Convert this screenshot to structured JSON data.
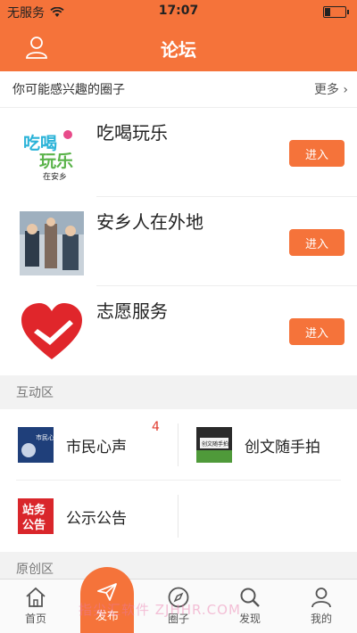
{
  "status_bar": {
    "carrier": "无服务",
    "time": "17:07"
  },
  "header": {
    "title": "论坛"
  },
  "interest": {
    "title": "你可能感兴趣的圈子",
    "more": "更多 ›"
  },
  "circles": [
    {
      "name": "吃喝玩乐",
      "join": "进入",
      "thumb_line1": "吃喝",
      "thumb_line2": "玩乐",
      "thumb_sub": "在安乡"
    },
    {
      "name": "安乡人在外地",
      "join": "进入"
    },
    {
      "name": "志愿服务",
      "join": "进入"
    }
  ],
  "interaction": {
    "title": "互动区",
    "items": [
      {
        "label": "市民心声",
        "badge": "4",
        "icon_text": "市民心声"
      },
      {
        "label": "创文随手拍",
        "icon_text": "创文随手拍"
      },
      {
        "label": "公示公告",
        "icon_text_1": "站务",
        "icon_text_2": "公告"
      }
    ]
  },
  "original": {
    "title": "原创区"
  },
  "tabbar": {
    "home": "首页",
    "publish": "发布",
    "circle": "圈子",
    "discover": "发现",
    "mine": "我的"
  },
  "watermark": "指尖汇软件 ZJHHR.COM",
  "colors": {
    "accent": "#f5733a",
    "badge": "#e03b2e"
  }
}
